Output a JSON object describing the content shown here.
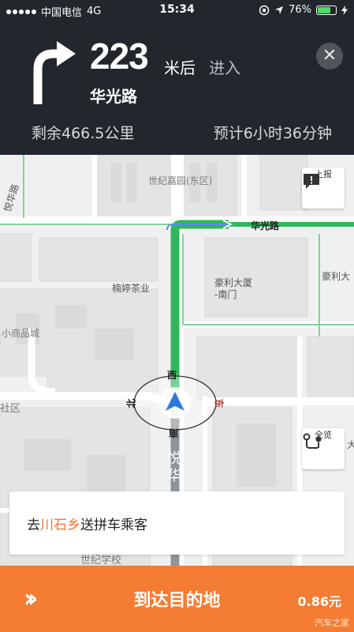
{
  "status_bar": {
    "carrier": "中国电信",
    "network": "4G",
    "time": "15:34",
    "battery": "76%",
    "battery_level": 0.76
  },
  "nav": {
    "turn_icon": "turn-right-arrow",
    "distance": "223",
    "unit": "米后",
    "action": "进入",
    "road": "华光路",
    "close_icon": "close-icon",
    "remaining": "剩余466.5公里",
    "eta": "预计6小时36分钟"
  },
  "map": {
    "labels": {
      "shiji_jiayuan": "世纪嘉园(东区)",
      "huaguang_road": "华光路",
      "yuehua_road_top": "悦华路",
      "nanting_tea": "楠婷茶业",
      "haoli_building": "豪利大厦",
      "haoli_south_gate": "-南门",
      "haoli_right": "豪利大",
      "small_goods": "小商品城",
      "community": "社区",
      "west": "西",
      "north": "北",
      "east": "东",
      "south": "南",
      "yuehua_road_bottom": "悦华",
      "da_right": "大",
      "shiji_school": "世纪学校"
    },
    "report_button": "上报",
    "overview_button": "全览"
  },
  "card": {
    "prefix": "去",
    "place": "川石乡",
    "suffix": "送拼车乘客"
  },
  "bottom": {
    "arrive_label": "到达目的地",
    "fare": "0.86元",
    "watermark": "汽车之家"
  },
  "colors": {
    "header_bg": "#22262d",
    "route_green": "#2fb75b",
    "accent_orange": "#f57c33"
  }
}
